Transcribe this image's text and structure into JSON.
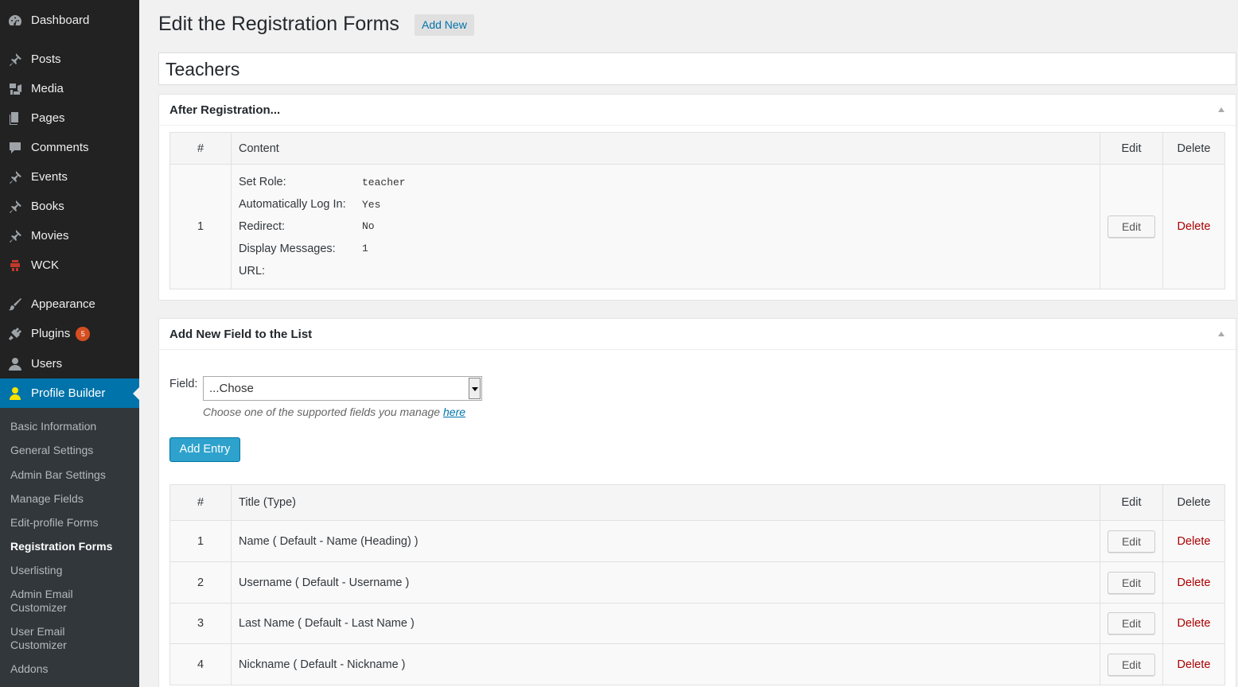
{
  "sidebar": {
    "menu": [
      {
        "label": "Dashboard",
        "icon": "dashboard-icon"
      },
      {
        "label": "Posts",
        "icon": "pushpin-icon"
      },
      {
        "label": "Media",
        "icon": "media-icon"
      },
      {
        "label": "Pages",
        "icon": "pages-icon"
      },
      {
        "label": "Comments",
        "icon": "comment-icon"
      },
      {
        "label": "Events",
        "icon": "pushpin-icon"
      },
      {
        "label": "Books",
        "icon": "pushpin-icon"
      },
      {
        "label": "Movies",
        "icon": "pushpin-icon"
      },
      {
        "label": "WCK",
        "icon": "wck-icon"
      },
      {
        "label": "Appearance",
        "icon": "paintbrush-icon"
      },
      {
        "label": "Plugins",
        "icon": "plugin-icon",
        "badge": "5"
      },
      {
        "label": "Users",
        "icon": "users-icon"
      },
      {
        "label": "Profile Builder",
        "icon": "profile-icon"
      }
    ],
    "submenu": [
      "Basic Information",
      "General Settings",
      "Admin Bar Settings",
      "Manage Fields",
      "Edit-profile Forms",
      "Registration Forms",
      "Userlisting",
      "Admin Email Customizer",
      "User Email Customizer",
      "Addons"
    ],
    "current_submenu": "Registration Forms"
  },
  "header": {
    "title": "Edit the Registration Forms",
    "add_new": "Add New"
  },
  "form_title": "Teachers",
  "after_registration": {
    "heading": "After Registration...",
    "columns": {
      "num": "#",
      "content": "Content",
      "edit": "Edit",
      "delete": "Delete"
    },
    "row": {
      "num": "1",
      "fields": [
        {
          "key": "Set Role:",
          "value": "teacher"
        },
        {
          "key": "Automatically Log In:",
          "value": "Yes"
        },
        {
          "key": "Redirect:",
          "value": "No"
        },
        {
          "key": "Display Messages:",
          "value": "1"
        },
        {
          "key": "URL:",
          "value": ""
        }
      ],
      "edit": "Edit",
      "delete": "Delete"
    }
  },
  "add_field": {
    "heading": "Add New Field to the List",
    "field_label": "Field:",
    "select_value": "...Chose",
    "help_text": "Choose one of the supported fields you manage",
    "help_link": "here",
    "button": "Add Entry",
    "columns": {
      "num": "#",
      "title": "Title (Type)",
      "edit": "Edit",
      "delete": "Delete"
    },
    "rows": [
      {
        "num": "1",
        "title": "Name ( Default - Name (Heading) )",
        "edit": "Edit",
        "delete": "Delete"
      },
      {
        "num": "2",
        "title": "Username ( Default - Username )",
        "edit": "Edit",
        "delete": "Delete"
      },
      {
        "num": "3",
        "title": "Last Name ( Default - Last Name )",
        "edit": "Edit",
        "delete": "Delete"
      },
      {
        "num": "4",
        "title": "Nickname ( Default - Nickname )",
        "edit": "Edit",
        "delete": "Delete"
      }
    ]
  }
}
